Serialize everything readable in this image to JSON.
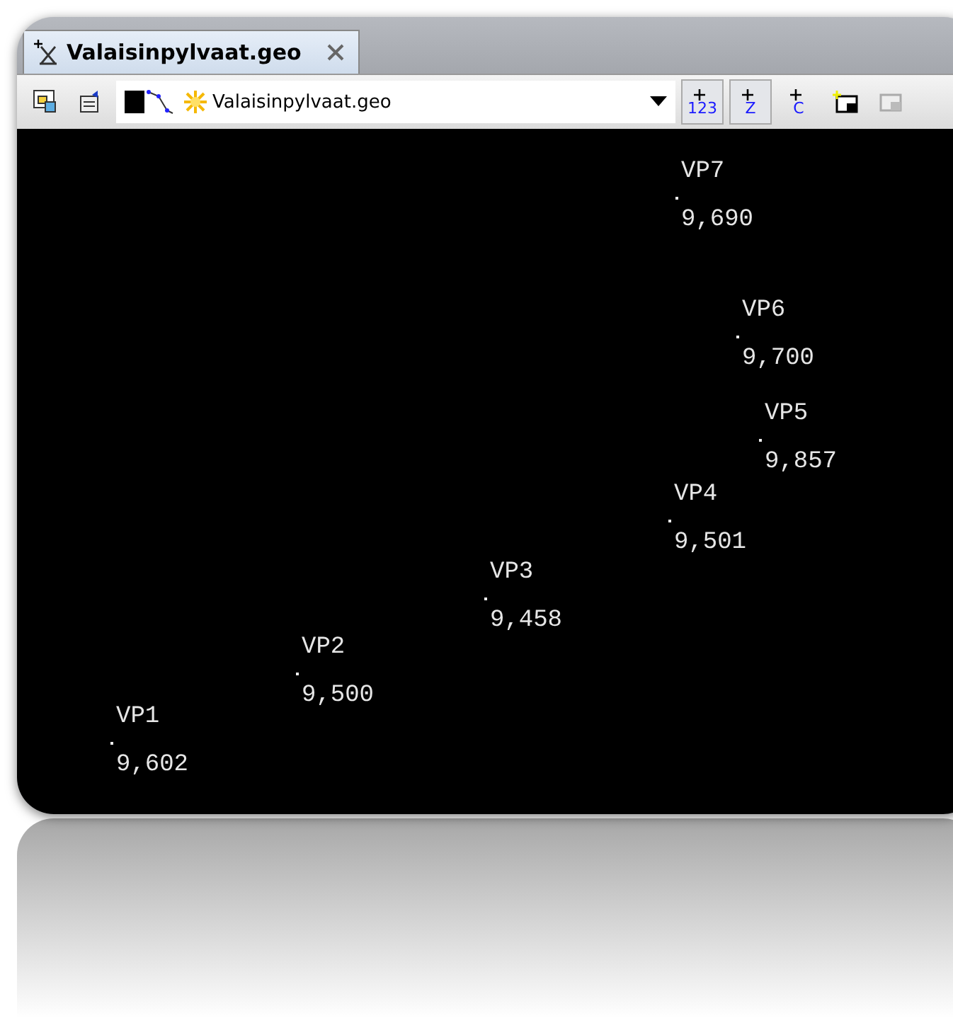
{
  "tab": {
    "title": "Valaisinpylvaat.geo",
    "selected": true
  },
  "layer_selector": {
    "value": "Valaisinpylvaat.geo"
  },
  "toolbar_toggles": [
    {
      "label": "123",
      "selected": true
    },
    {
      "label": "Z",
      "selected": true
    },
    {
      "label": "C",
      "selected": false
    }
  ],
  "points": [
    {
      "name": "VP1",
      "value": "9,602"
    },
    {
      "name": "VP2",
      "value": "9,500"
    },
    {
      "name": "VP3",
      "value": "9,458"
    },
    {
      "name": "VP4",
      "value": "9,501"
    },
    {
      "name": "VP5",
      "value": "9,857"
    },
    {
      "name": "VP6",
      "value": "9,700"
    },
    {
      "name": "VP7",
      "value": "9,690"
    }
  ]
}
